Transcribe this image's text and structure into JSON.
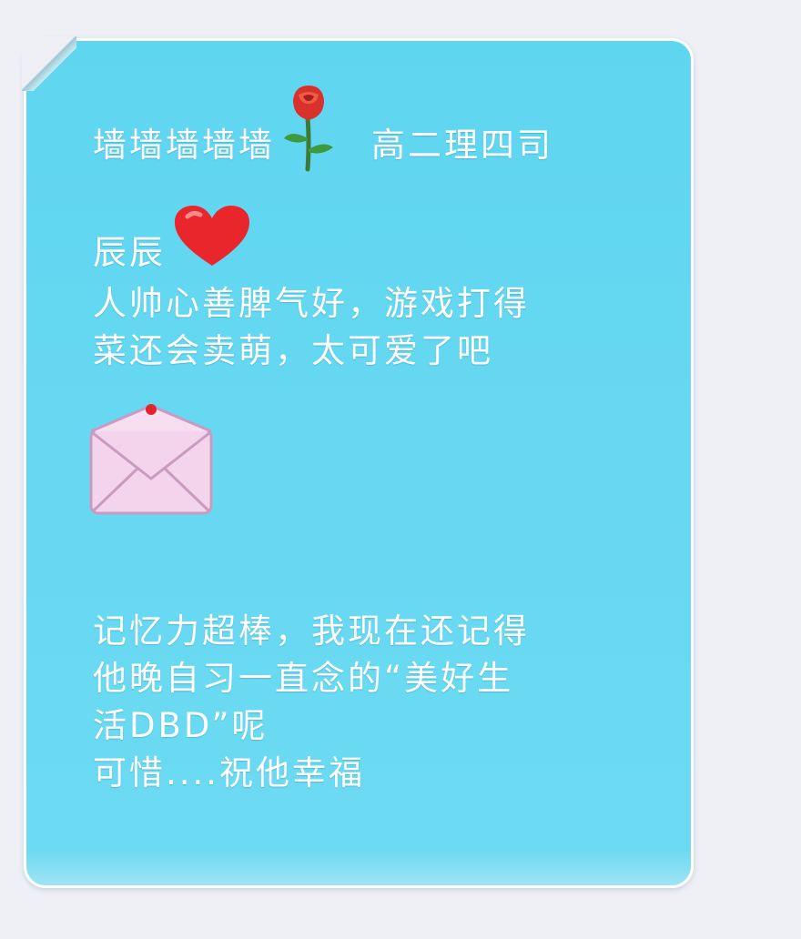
{
  "message": {
    "line1_prefix": "墙墙墙墙墙",
    "rose_icon": "rose-icon",
    "line1_suffix": "高二理四司",
    "line2_name": "辰辰",
    "heart_icon": "red-heart-icon",
    "paragraph1": [
      "人帅心善脾气好，游戏打得",
      "菜还会卖萌，太可爱了吧"
    ],
    "envelope_icon": "love-letter-icon",
    "paragraph2": [
      "记忆力超棒，我现在还记得",
      "他晚自习一直念的“美好生",
      "活DBD”呢",
      "可惜....祝他幸福"
    ]
  },
  "colors": {
    "bubble": "#62d7f1",
    "text": "#ffffff",
    "page_bg": "#eef0f5"
  }
}
